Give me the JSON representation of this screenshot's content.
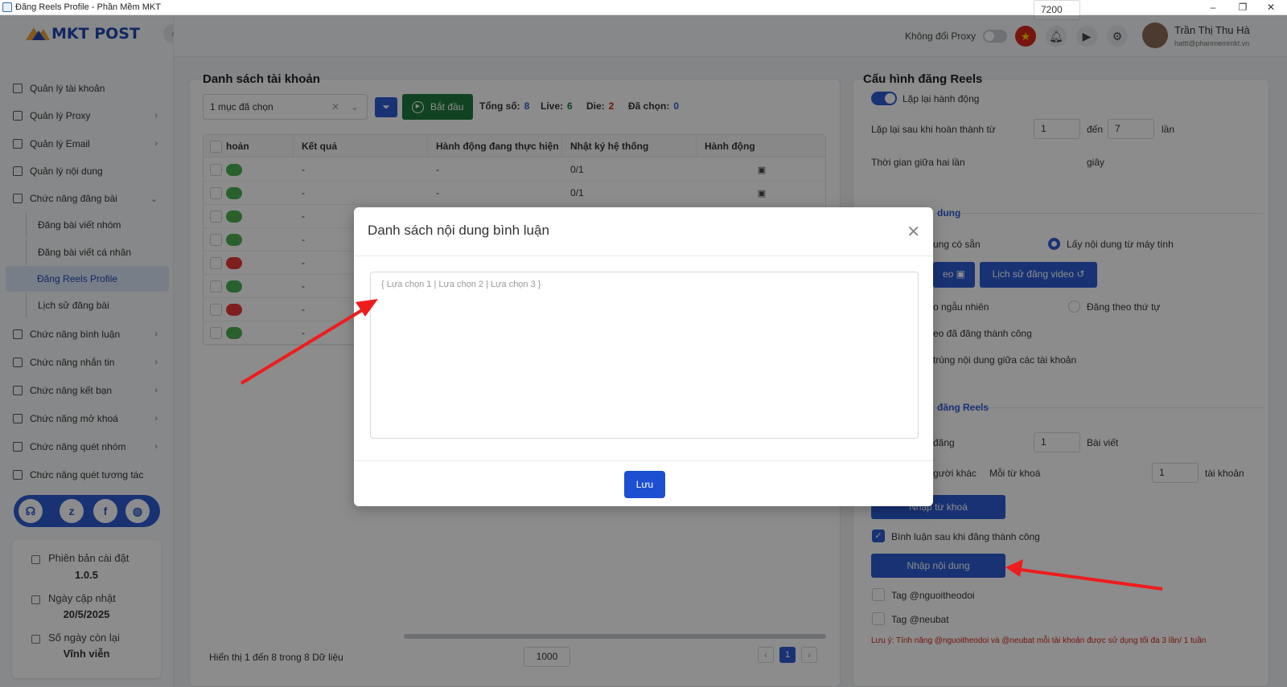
{
  "window": {
    "title": "Đăng Reels Profile - Phần Mềm MKT"
  },
  "brand": {
    "logo_text": "MKT POST"
  },
  "sidebar": {
    "items": [
      {
        "label": "Quản lý tài khoản",
        "icon": "grid-icon"
      },
      {
        "label": "Quản lý Proxy",
        "icon": "layers-icon"
      },
      {
        "label": "Quản lý Email",
        "icon": "mail-icon"
      },
      {
        "label": "Quản lý nội dung",
        "icon": "content-icon"
      },
      {
        "label": "Chức năng đăng bài",
        "icon": "post-icon"
      },
      {
        "label": "Chức năng bình luận",
        "icon": "comment-icon"
      },
      {
        "label": "Chức năng nhắn tin",
        "icon": "chat-icon"
      },
      {
        "label": "Chức năng kết bạn",
        "icon": "add-friend-icon"
      },
      {
        "label": "Chức năng mở khoá",
        "icon": "lock-icon"
      },
      {
        "label": "Chức năng quét nhóm",
        "icon": "group-icon"
      },
      {
        "label": "Chức năng quét tương tác",
        "icon": "scan-icon"
      }
    ],
    "sub_items": [
      {
        "label": "Đăng bài viết nhóm"
      },
      {
        "label": "Đăng bài viết cá nhân"
      },
      {
        "label": "Đăng Reels Profile"
      },
      {
        "label": "Lịch sử đăng bài"
      }
    ],
    "info": {
      "version_label": "Phiên bản cài đặt",
      "version_value": "1.0.5",
      "update_label": "Ngày cập nhật",
      "update_value": "20/5/2025",
      "days_label": "Số ngày còn lại",
      "days_value": "Vĩnh viễn"
    }
  },
  "topbar": {
    "proxy_label": "Không đổi Proxy",
    "user_name": "Trần Thị Thu Hà",
    "user_email": "hattt@phanmemmkt.vn"
  },
  "accounts": {
    "title": "Danh sách tài khoản",
    "select_value": "1 mục đã chọn",
    "start_label": "Bắt đầu",
    "total_label": "Tổng số:",
    "total_value": "8",
    "live_label": "Live:",
    "live_value": "6",
    "die_label": "Die:",
    "die_value": "2",
    "selected_label": "Đã chọn:",
    "selected_value": "0",
    "columns": [
      "hoản",
      "Kết quả",
      "Hành động đang thực hiện",
      "Nhật ký hệ thống",
      "Hành động"
    ],
    "rows": [
      {
        "status": "live",
        "result": "-",
        "action": "-",
        "log": "0/1"
      },
      {
        "status": "live",
        "result": "-",
        "action": "-",
        "log": "0/1"
      },
      {
        "status": "live",
        "result": "-",
        "action": "",
        "log": ""
      },
      {
        "status": "live",
        "result": "-",
        "action": "",
        "log": ""
      },
      {
        "status": "die",
        "result": "-",
        "action": "",
        "log": ""
      },
      {
        "status": "live",
        "result": "-",
        "action": "",
        "log": ""
      },
      {
        "status": "die",
        "result": "-",
        "action": "",
        "log": ""
      },
      {
        "status": "live",
        "result": "-",
        "action": "",
        "log": ""
      }
    ],
    "footer_text": "Hiển thị 1 đến 8 trong 8 Dữ liệu",
    "page_size": "1000",
    "current_page": "1"
  },
  "config": {
    "title": "Cấu hình đăng Reels",
    "repeat_label": "Lặp lại hành động",
    "repeat_after_label": "Lặp lại sau khi hoàn thành từ",
    "repeat_from": "1",
    "to_label": "đến",
    "repeat_to": "7",
    "times_label": "lần",
    "interval_label": "Thời gian giữa hai lần",
    "interval_value": "7200",
    "seconds_label": "giây",
    "section_content": "dung",
    "available_content": "ung có sẵn",
    "from_computer": "Lấy nội dung từ máy tính",
    "video_btn": "eo",
    "history_btn": "Lịch sử đăng video",
    "random": "o ngẫu nhiên",
    "sequential": "Đăng theo thứ tự",
    "success_videos": "eo đã đăng thành công",
    "duplicate": "trùng nội dung giữa các tài khoản",
    "section_reels": "đăng Reels",
    "post_count_label": "đăng",
    "post_count": "1",
    "post_unit": "Bài viết",
    "others_label": "gười khác",
    "per_keyword": "Mỗi từ khoá",
    "per_keyword_value": "1",
    "account_unit": "tài khoản",
    "keyword_btn": "Nhập từ khoá",
    "comment_after": "Bình luận sau khi đăng thành công",
    "content_btn": "Nhập nội dung",
    "tag_friends": "Tag @nguoitheodoi",
    "tag_self": "Tag @neubat",
    "note": "Lưu ý: Tính năng @nguoitheodoi và @neubat mỗi tài khoản được sử dụng tối đa 3 lần/ 1 tuần"
  },
  "modal": {
    "title": "Danh sách nội dung bình luận",
    "placeholder": "{ Lựa chọn 1 | Lựa chọn 2 | Lựa chọn 3 }",
    "save_label": "Lưu"
  },
  "colors": {
    "primary": "#2d5bd4",
    "success": "#1e7a3c",
    "danger": "#d0271c",
    "live": "#4caf50",
    "die": "#e53935"
  }
}
